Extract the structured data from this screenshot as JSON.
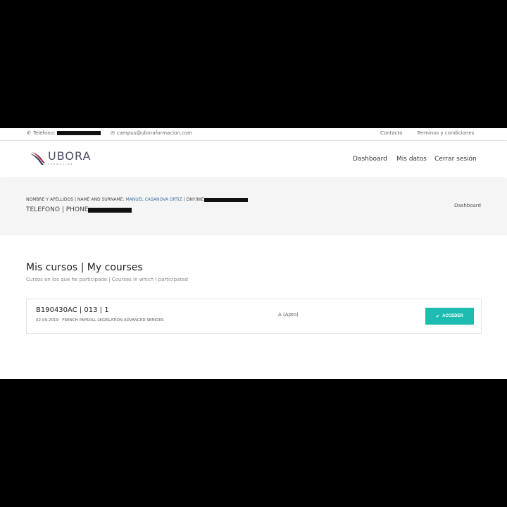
{
  "topbar": {
    "phone_label": "Telefono:",
    "email": "campus@uboraformacion.com",
    "contact": "Contacto",
    "terms": "Terminos y condiciones"
  },
  "brand": {
    "logo_text": "UBORA",
    "logo_tagline": "FORMACION"
  },
  "nav": {
    "items": [
      "Dashboard",
      "Mis datos",
      "Cerrar sesión"
    ]
  },
  "profile": {
    "name_label": "NOMBRE Y APELLIDOS | NAME AND SURNAME:",
    "name_value": "MANUEL CASANOVA ORTIZ",
    "id_label": "| DNY/NIE",
    "phone_label": "TELEFONO | PHONE"
  },
  "breadcrumb": "Dashboard",
  "courses": {
    "title": "Mis cursos | My courses",
    "subtitle": "Cursos en los que he participado | Courses in which I participated",
    "items": [
      {
        "code": "B190430AC | 013 | 1",
        "date": "02-09-2019",
        "name": "FRENCH PAYROLL LEGISLATION ADVANCED SENIORS",
        "grade": "A (Apto)",
        "action": "ACCEDER"
      }
    ]
  },
  "colors": {
    "accent": "#1cbdb0",
    "link": "#3a6ea5",
    "logo_red": "#b0203a",
    "logo_navy": "#2c3e66"
  }
}
